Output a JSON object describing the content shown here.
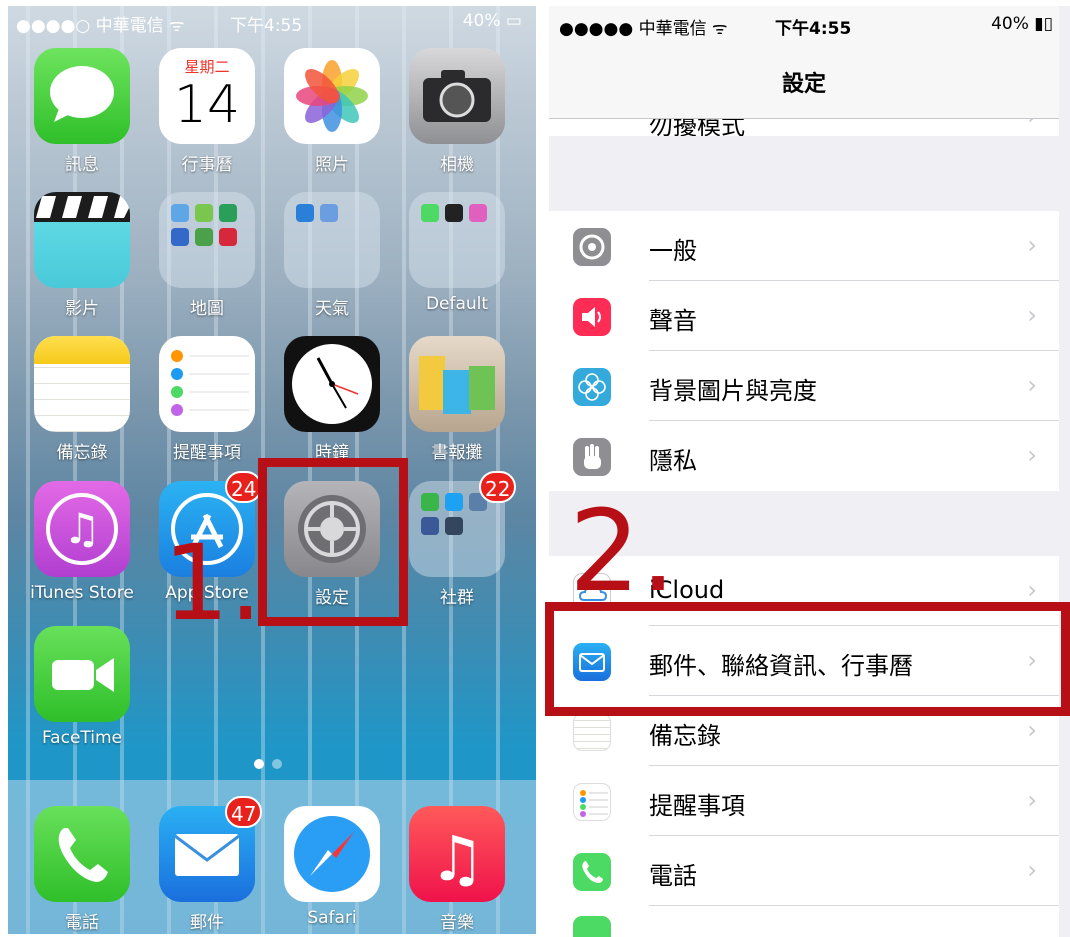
{
  "home": {
    "status": {
      "carrier": "●●●●○ 中華電信 ᯤ",
      "time": "下午4:55",
      "battery": "40% ▭"
    },
    "calendar": {
      "weekday": "星期二",
      "day": "14"
    },
    "apps": {
      "messages": "訊息",
      "calendar": "行事曆",
      "photos": "照片",
      "camera": "相機",
      "videos": "影片",
      "maps": "地圖",
      "weather": "天氣",
      "default": "Default",
      "notes": "備忘錄",
      "reminders": "提醒事項",
      "clock": "時鐘",
      "newsstand": "書報攤",
      "itunes": "iTunes Store",
      "appstore": "App Store",
      "settings": "設定",
      "social": "社群",
      "facetime": "FaceTime"
    },
    "badges": {
      "appstore": "24",
      "social": "22",
      "mail": "47"
    },
    "dock": {
      "phone": "電話",
      "mail": "郵件",
      "safari": "Safari",
      "music": "音樂"
    },
    "annotation": "1."
  },
  "settings": {
    "status": {
      "carrier": "●●●●● 中華電信 ᯤ",
      "time": "下午4:55",
      "battery": "40% ▮▯"
    },
    "title": "設定",
    "rows": {
      "partial_top": "勿擾模式",
      "general": "一般",
      "sounds": "聲音",
      "wallpaper": "背景圖片與亮度",
      "privacy": "隱私",
      "icloud": "iCloud",
      "mail": "郵件、聯絡資訊、行事曆",
      "notes": "備忘錄",
      "reminders": "提醒事項",
      "phone": "電話"
    },
    "chevron": "›",
    "annotation": "2."
  },
  "colors": {
    "annotation_red": "#b70f16",
    "badge_red": "#e8211d"
  }
}
